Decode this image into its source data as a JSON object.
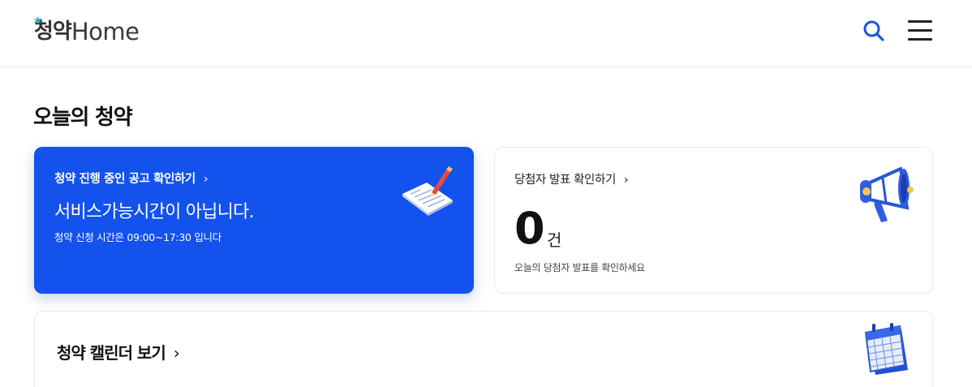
{
  "header": {
    "logo_star": "*",
    "logo_korean": "청약",
    "logo_english": "Home"
  },
  "section_title": "오늘의 청약",
  "card_ongoing": {
    "link_label": "청약 진행 중인 공고 확인하기",
    "chevron": "›",
    "status_text": "서비스가능시간이 아닙니다.",
    "hours_text": "청약 신청 시간은 09:00~17:30 입니다"
  },
  "card_winners": {
    "link_label": "당첨자 발표 확인하기",
    "chevron": "›",
    "count": "0",
    "unit": "건",
    "sub_text": "오늘의 당첨자 발표를 확인하세요"
  },
  "card_calendar": {
    "label": "청약 캘린더 보기",
    "chevron": "›"
  },
  "colors": {
    "primary_blue": "#1352ec",
    "logo_teal": "#17a3b8",
    "search_blue": "#1a56db"
  },
  "icons": [
    "search-icon",
    "hamburger-menu-icon",
    "document-pen-icon",
    "megaphone-icon",
    "calendar-icon"
  ]
}
